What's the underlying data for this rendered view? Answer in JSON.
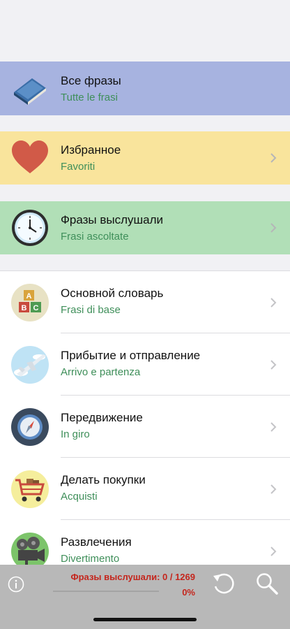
{
  "special": [
    {
      "title": "Все фразы",
      "subtitle": "Tutte le frasi",
      "icon": "book-icon",
      "bg": "#a7b3e0",
      "chevron": false
    },
    {
      "title": "Избранное",
      "subtitle": "Favoriti",
      "icon": "heart-icon",
      "bg": "#f9e49c",
      "chevron": true
    },
    {
      "title": "Фразы выслушали",
      "subtitle": "Frasi ascoltate",
      "icon": "clock-icon",
      "bg": "#b1dfb7",
      "chevron": true
    }
  ],
  "categories": [
    {
      "title": "Основной словарь",
      "subtitle": "Frasi di base",
      "icon": "abc-blocks-icon"
    },
    {
      "title": "Прибытие и отправление",
      "subtitle": "Arrivo e partenza",
      "icon": "airplane-icon"
    },
    {
      "title": "Передвижение",
      "subtitle": "In giro",
      "icon": "compass-icon"
    },
    {
      "title": "Делать покупки",
      "subtitle": "Acquisti",
      "icon": "shopping-cart-icon"
    },
    {
      "title": "Развлечения",
      "subtitle": "Divertimento",
      "icon": "movie-camera-icon"
    }
  ],
  "footer": {
    "heard_label": "Фразы выслушали: 0 / 1269",
    "percent_label": "0%",
    "progress": 0,
    "info_icon": "info-icon",
    "refresh_icon": "refresh-icon",
    "search_icon": "search-icon"
  },
  "colors": {
    "subtitle": "#3f8f5a",
    "stat": "#c4261d",
    "toolbar": "#b8b8b8"
  }
}
